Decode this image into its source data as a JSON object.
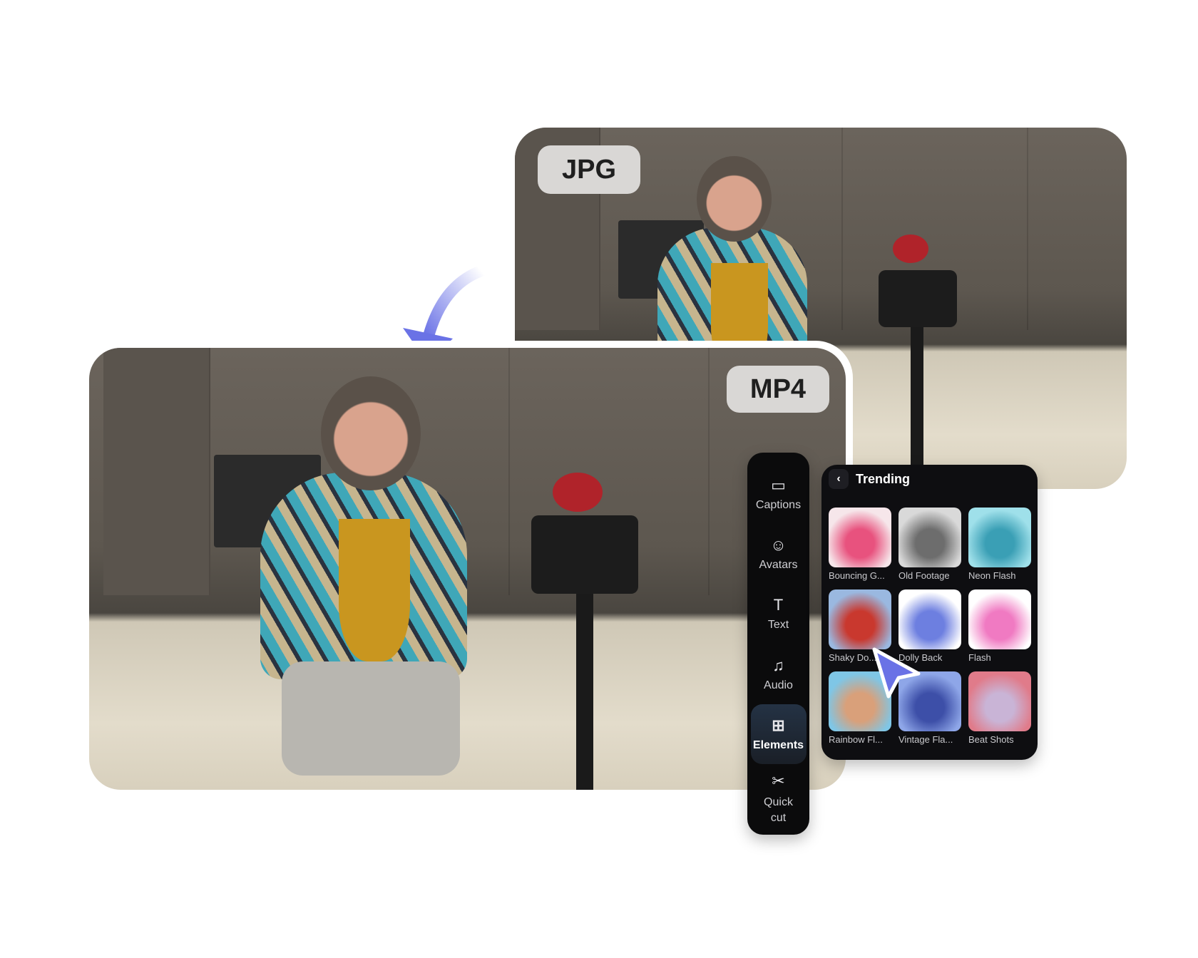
{
  "badges": {
    "jpg": "JPG",
    "mp4": "MP4"
  },
  "sidebar": {
    "items": [
      {
        "label": "Captions",
        "icon": "captions-icon",
        "glyph": "▭"
      },
      {
        "label": "Avatars",
        "icon": "avatar-icon",
        "glyph": "☺"
      },
      {
        "label": "Text",
        "icon": "text-icon",
        "glyph": "T"
      },
      {
        "label": "Audio",
        "icon": "music-note-icon",
        "glyph": "♫"
      },
      {
        "label": "Elements",
        "icon": "elements-icon",
        "glyph": "⊞",
        "active": true
      },
      {
        "label": "Quick cut",
        "icon": "scissors-icon",
        "glyph": "✂"
      }
    ]
  },
  "panel": {
    "back_glyph": "‹",
    "title": "Trending",
    "items": [
      {
        "label": "Bouncing G...",
        "colors": [
          "#f6e6ea",
          "#e8527e"
        ]
      },
      {
        "label": "Old Footage",
        "colors": [
          "#d9d9d9",
          "#6d6d6d"
        ]
      },
      {
        "label": "Neon Flash",
        "colors": [
          "#9fe0ea",
          "#3a9fb5"
        ]
      },
      {
        "label": "Shaky Do...",
        "colors": [
          "#9ab8e0",
          "#c9382e"
        ]
      },
      {
        "label": "Dolly Back",
        "colors": [
          "#ffffff",
          "#6d7fe0"
        ]
      },
      {
        "label": "Flash",
        "colors": [
          "#ffffff",
          "#f07ac2"
        ]
      },
      {
        "label": "Rainbow Fl...",
        "colors": [
          "#7fc6e6",
          "#d9a07a"
        ]
      },
      {
        "label": "Vintage Fla...",
        "colors": [
          "#8ea6e8",
          "#3d4fa8"
        ]
      },
      {
        "label": "Beat Shots",
        "colors": [
          "#e07b8a",
          "#c9b4d6"
        ]
      }
    ]
  },
  "colors": {
    "accent": "#6a72e6",
    "panel_bg": "#0e0e11"
  }
}
